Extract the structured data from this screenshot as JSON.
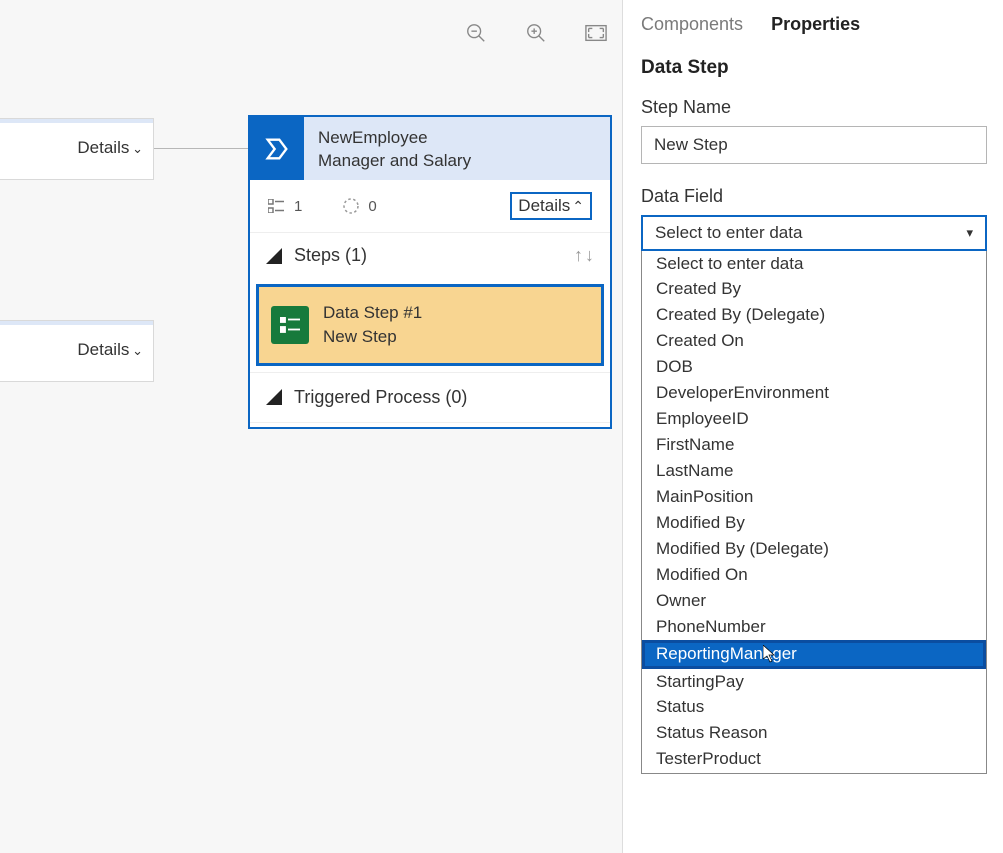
{
  "canvas": {
    "zoom": {
      "out": "zoom-out",
      "in": "zoom-in",
      "fit": "fit-screen"
    },
    "partial_boxes": [
      {
        "details_label": "Details"
      },
      {
        "details_label": "Details"
      }
    ],
    "stage": {
      "title_line1": "NewEmployee",
      "title_line2": "Manager and Salary",
      "steps_count_label": "1",
      "trigger_count_label": "0",
      "details_label": "Details",
      "steps_header": "Steps (1)",
      "data_step": {
        "line1": "Data Step #1",
        "line2": "New Step"
      },
      "triggered_header": "Triggered Process (0)"
    }
  },
  "panel": {
    "tabs": {
      "components": "Components",
      "properties": "Properties"
    },
    "section_title": "Data Step",
    "step_name_label": "Step Name",
    "step_name_value": "New Step",
    "data_field_label": "Data Field",
    "data_field_placeholder": "Select to enter data",
    "dropdown": {
      "options": [
        "Select to enter data",
        "Created By",
        "Created By (Delegate)",
        "Created On",
        "DOB",
        "DeveloperEnvironment",
        "EmployeeID",
        "FirstName",
        "LastName",
        "MainPosition",
        "Modified By",
        "Modified By (Delegate)",
        "Modified On",
        "Owner",
        "PhoneNumber",
        "ReportingManager",
        "StartingPay",
        "Status",
        "Status Reason",
        "TesterProduct"
      ],
      "highlighted_index": 15
    }
  }
}
